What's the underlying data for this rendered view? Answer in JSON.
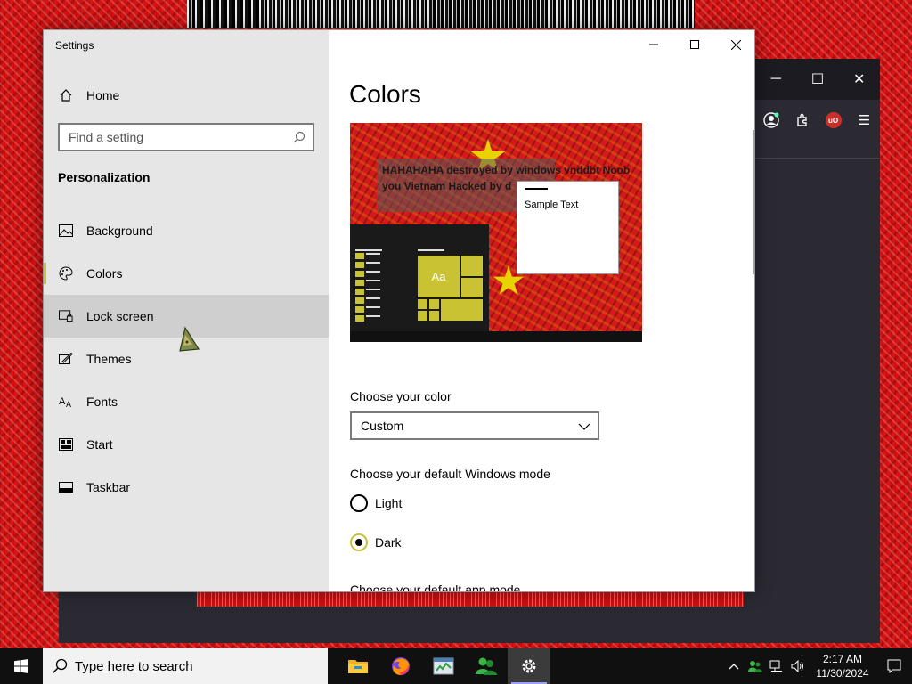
{
  "settings_window": {
    "title": "Settings",
    "home_label": "Home",
    "search_placeholder": "Find a setting",
    "section": "Personalization",
    "nav": [
      {
        "label": "Background",
        "icon": "picture-icon"
      },
      {
        "label": "Colors",
        "icon": "palette-icon",
        "selected": true
      },
      {
        "label": "Lock screen",
        "icon": "lock-screen-icon",
        "hover": true
      },
      {
        "label": "Themes",
        "icon": "brush-icon"
      },
      {
        "label": "Fonts",
        "icon": "font-icon"
      },
      {
        "label": "Start",
        "icon": "start-icon"
      },
      {
        "label": "Taskbar",
        "icon": "taskbar-icon"
      }
    ],
    "caption_buttons": [
      "minimize",
      "maximize",
      "close"
    ]
  },
  "colors_page": {
    "title": "Colors",
    "preview": {
      "banner_text": "HAHAHAHA destroyed by windows vnddbt Noob you Vietnam Hacked by d",
      "sample_text": "Sample Text",
      "tile_text": "Aa"
    },
    "choose_color_label": "Choose your color",
    "color_value": "Custom",
    "windows_mode_label": "Choose your default Windows mode",
    "modes": [
      {
        "label": "Light",
        "checked": false
      },
      {
        "label": "Dark",
        "checked": true
      }
    ],
    "app_mode_label": "Choose your default app mode"
  },
  "taskbar": {
    "search_placeholder": "Type here to search",
    "apps": [
      "file-explorer-icon",
      "firefox-icon",
      "task-manager-icon",
      "people-icon",
      "settings-icon"
    ],
    "time": "2:17 AM",
    "date": "11/30/2024"
  },
  "colors": {
    "accent": "#c9c232",
    "sidebar_bg": "#e6e6e6",
    "taskbar_bg": "#101010",
    "desktop_bg": "#d81313"
  }
}
